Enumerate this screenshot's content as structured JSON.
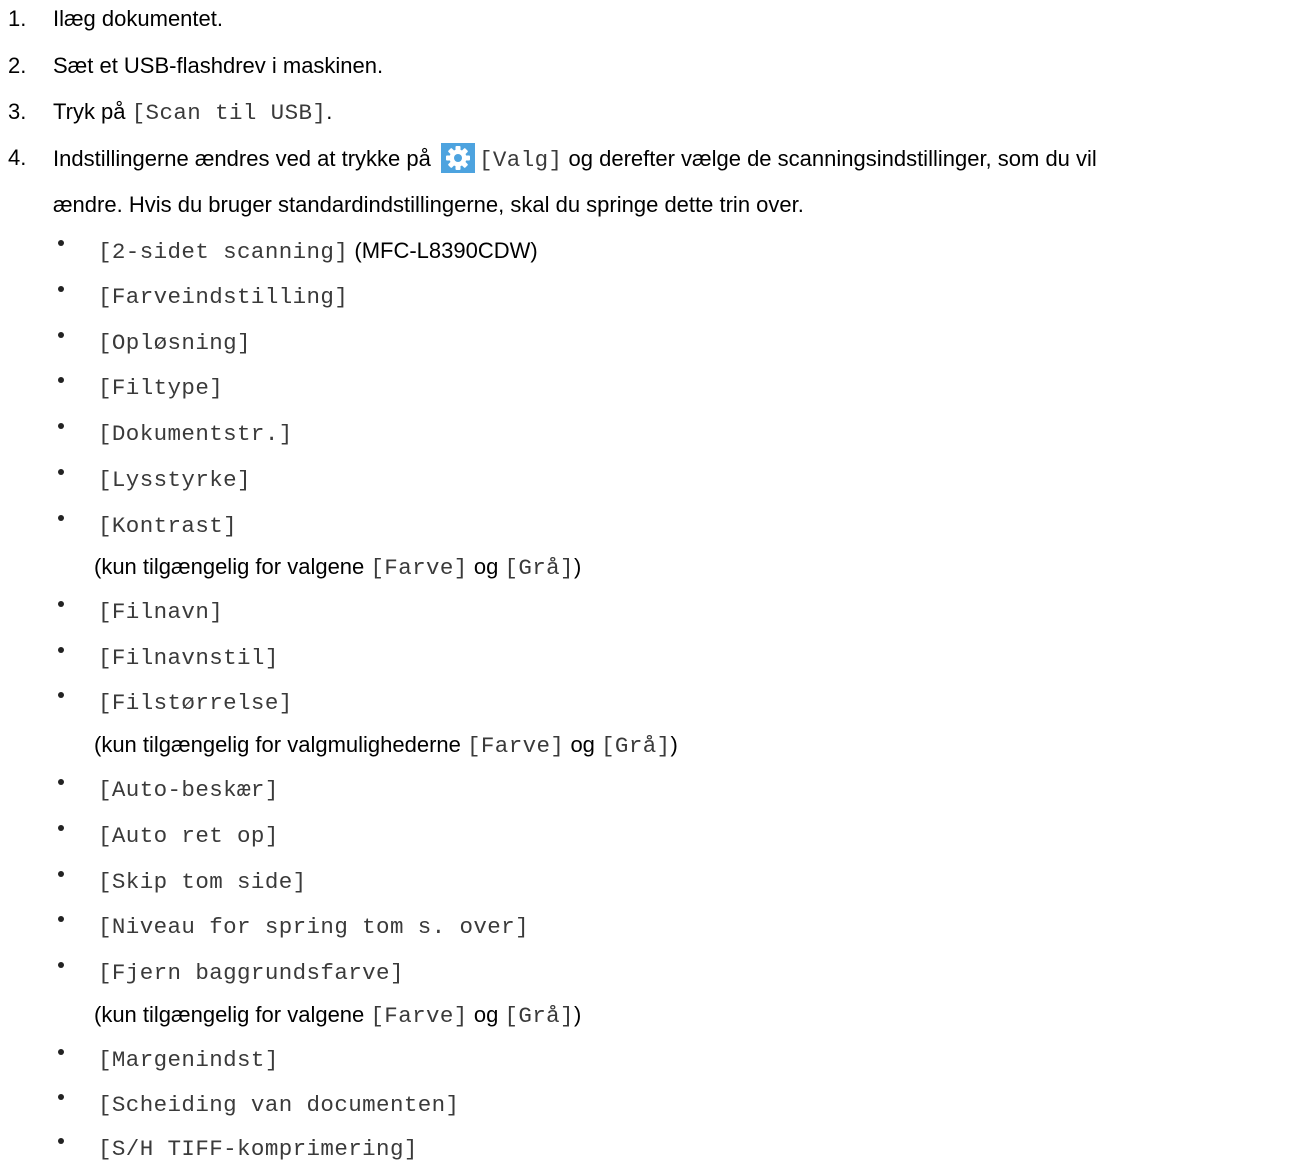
{
  "steps": [
    {
      "number": "1.",
      "text": "Ilæg dokumentet."
    },
    {
      "number": "2.",
      "text": "Sæt et USB-flashdrev i maskinen."
    },
    {
      "number": "3.",
      "text_before": "Tryk på ",
      "code": "[Scan til USB]",
      "text_after": "."
    },
    {
      "number": "4.",
      "text_before": "Indstillingerne ændres ved at trykke på ",
      "icon": "gear-icon",
      "code": "[Valg]",
      "text_after": " og derefter vælge de scanningsindstillinger, som du vil",
      "line2": "ændre. Hvis du bruger standardindstillingerne, skal du springe dette trin over."
    }
  ],
  "options": [
    {
      "code": "[2-sidet scanning]",
      "suffix": " (MFC-L8390CDW)"
    },
    {
      "code": "[Farveindstilling]"
    },
    {
      "code": "[Opløsning]"
    },
    {
      "code": "[Filtype]"
    },
    {
      "code": "[Dokumentstr.]"
    },
    {
      "code": "[Lysstyrke]"
    },
    {
      "code": "[Kontrast]"
    },
    {
      "code": "[Filnavn]"
    },
    {
      "code": "[Filnavnstil]"
    },
    {
      "code": "[Filstørrelse]"
    },
    {
      "code": "[Auto-beskær]"
    },
    {
      "code": "[Auto ret op]"
    },
    {
      "code": "[Skip tom side]"
    },
    {
      "code": "[Niveau for spring tom s. over]"
    },
    {
      "code": "[Fjern baggrundsfarve]"
    },
    {
      "code": "[Margenindst]"
    },
    {
      "code": "[Scheiding van documenten]"
    },
    {
      "code": "[S/H TIFF-komprimering]"
    }
  ],
  "notes": {
    "kontrast": {
      "prefix": "(kun tilgængelig for valgene ",
      "code1": "[Farve]",
      "mid": " og ",
      "code2": "[Grå]",
      "suffix": ")"
    },
    "filstorrelse": {
      "prefix": "(kun tilgængelig for valgmulighederne ",
      "code1": "[Farve]",
      "mid": " og ",
      "code2": "[Grå]",
      "suffix": ")"
    },
    "baggrund": {
      "prefix": "(kun tilgængelig for valgene ",
      "code1": "[Farve]",
      "mid": " og ",
      "code2": "[Grå]",
      "suffix": ")"
    }
  },
  "colors": {
    "icon_bg": "#4da3df",
    "code_text": "#3a3a3a"
  }
}
